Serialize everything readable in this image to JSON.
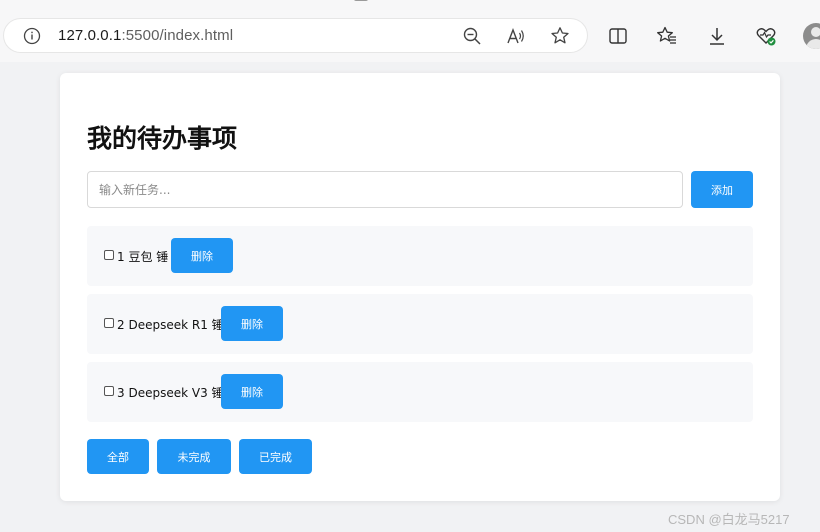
{
  "browser": {
    "url_host": "127.0.0.1",
    "url_path": ":5500/index.html"
  },
  "page": {
    "title": "我的待办事项",
    "input_placeholder": "输入新任务...",
    "add_label": "添加",
    "todos": [
      {
        "text": "1 豆包 锤",
        "delete_label": "删除",
        "done": false
      },
      {
        "text": "2 Deepseek R1 锤",
        "delete_label": "删除",
        "done": false
      },
      {
        "text": "3 Deepseek V3 锤",
        "delete_label": "删除",
        "done": false
      }
    ],
    "filters": [
      {
        "label": "全部"
      },
      {
        "label": "未完成"
      },
      {
        "label": "已完成"
      }
    ]
  },
  "watermark": "CSDN @白龙马5217",
  "colors": {
    "accent": "#2196f3",
    "item_bg": "#f7f8fa",
    "page_bg": "#f1f2f4"
  }
}
